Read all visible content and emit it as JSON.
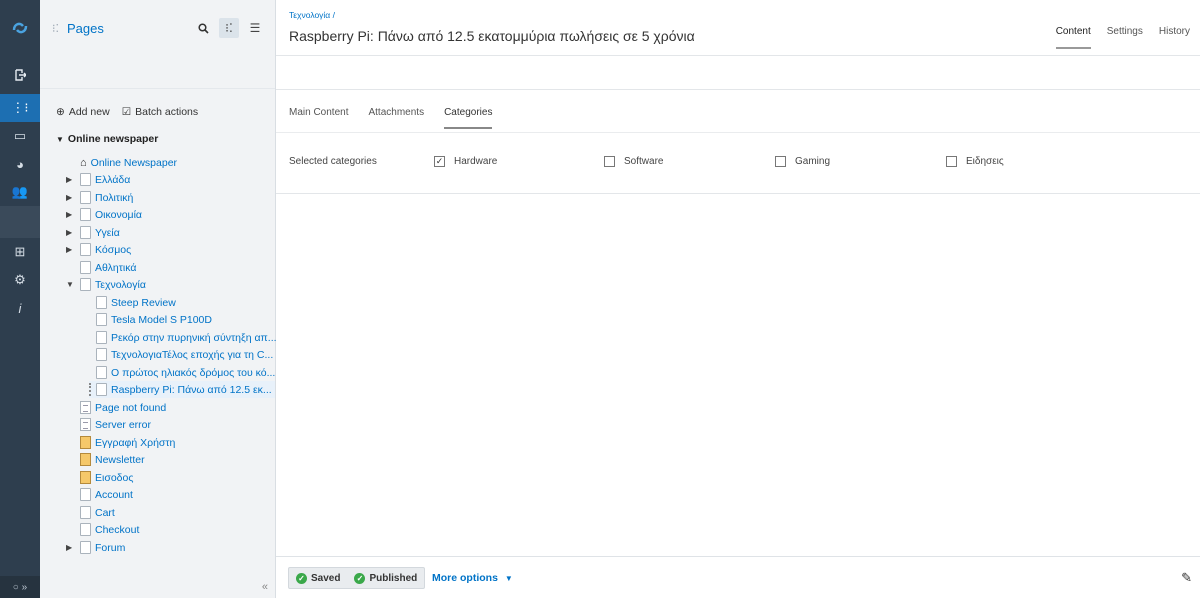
{
  "rail": {
    "icons": [
      "logo-icon",
      "logout-icon",
      "sitetree-icon",
      "image-icon",
      "pie-chart-icon",
      "users-icon",
      "basket-icon",
      "tools-icon",
      "info-icon"
    ],
    "bottom": "○ »"
  },
  "tree": {
    "title": "Pages",
    "actions": {
      "add": "Add new",
      "batch": "Batch actions"
    },
    "root": "Online newspaper",
    "nodes": [
      {
        "label": "Online Newspaper"
      },
      {
        "label": "Ελλάδα"
      },
      {
        "label": "Πολιτική"
      },
      {
        "label": "Οικονομία"
      },
      {
        "label": "Υγεία"
      },
      {
        "label": "Κόσμος"
      },
      {
        "label": "Αθλητικά"
      },
      {
        "label": "Τεχνολογία"
      },
      {
        "label": "Steep Review"
      },
      {
        "label": "Tesla Model S P100D"
      },
      {
        "label": "Ρεκόρ στην πυρηνική σύντηξη απ..."
      },
      {
        "label": "ΤεχνολογιαΤέλος εποχής για τη C..."
      },
      {
        "label": "Ο πρώτος ηλιακός δρόμος του κό..."
      },
      {
        "label": "Raspberry Pi: Πάνω από 12.5 εκ..."
      },
      {
        "label": "Page not found"
      },
      {
        "label": "Server error"
      },
      {
        "label": "Εγγραφή Χρήστη"
      },
      {
        "label": "Newsletter"
      },
      {
        "label": "Εισοδος"
      },
      {
        "label": "Account"
      },
      {
        "label": "Cart"
      },
      {
        "label": "Checkout"
      },
      {
        "label": "Forum"
      }
    ],
    "collapse": "«"
  },
  "header": {
    "breadcrumb": "Τεχνολογία /",
    "title": "Raspberry Pi: Πάνω από 12.5 εκατομμύρια πωλήσεις σε 5 χρόνια",
    "view_tabs": [
      "Content",
      "Settings",
      "History"
    ]
  },
  "subtabs": [
    "Main Content",
    "Attachments",
    "Categories"
  ],
  "categories": {
    "label": "Selected categories",
    "items": [
      {
        "label": "Hardware",
        "checked": true
      },
      {
        "label": "Software",
        "checked": false
      },
      {
        "label": "Gaming",
        "checked": false
      },
      {
        "label": "Ειδησεις",
        "checked": false
      }
    ]
  },
  "footer": {
    "saved": "Saved",
    "published": "Published",
    "more": "More options"
  }
}
